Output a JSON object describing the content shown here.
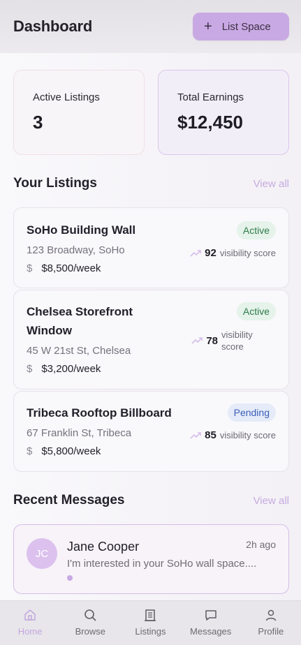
{
  "header": {
    "title": "Dashboard",
    "list_button_label": "List Space"
  },
  "stats": {
    "active_listings_label": "Active Listings",
    "active_listings_value": "3",
    "total_earnings_label": "Total Earnings",
    "total_earnings_value": "$12,450"
  },
  "listings_section": {
    "title": "Your Listings",
    "view_all": "View all"
  },
  "listings": [
    {
      "title": "SoHo Building Wall",
      "address": "123 Broadway, SoHo",
      "price": "$8,500/week",
      "status": "Active",
      "score": "92",
      "score_label": "visibility score"
    },
    {
      "title": "Chelsea Storefront Window",
      "address": "45 W 21st St, Chelsea",
      "price": "$3,200/week",
      "status": "Active",
      "score": "78",
      "score_label": "visibility score"
    },
    {
      "title": "Tribeca Rooftop Billboard",
      "address": "67 Franklin St, Tribeca",
      "price": "$5,800/week",
      "status": "Pending",
      "score": "85",
      "score_label": "visibility score"
    }
  ],
  "messages_section": {
    "title": "Recent Messages",
    "view_all": "View all"
  },
  "messages": [
    {
      "initials": "JC",
      "name": "Jane Cooper",
      "time": "2h ago",
      "text": "I'm interested in your SoHo wall space...."
    }
  ],
  "nav": {
    "home": "Home",
    "browse": "Browse",
    "listings": "Listings",
    "messages": "Messages",
    "profile": "Profile"
  },
  "colors": {
    "accent": "#c9a9e3",
    "active_badge": "#2f7a4a",
    "pending_badge": "#3a5ebc"
  }
}
